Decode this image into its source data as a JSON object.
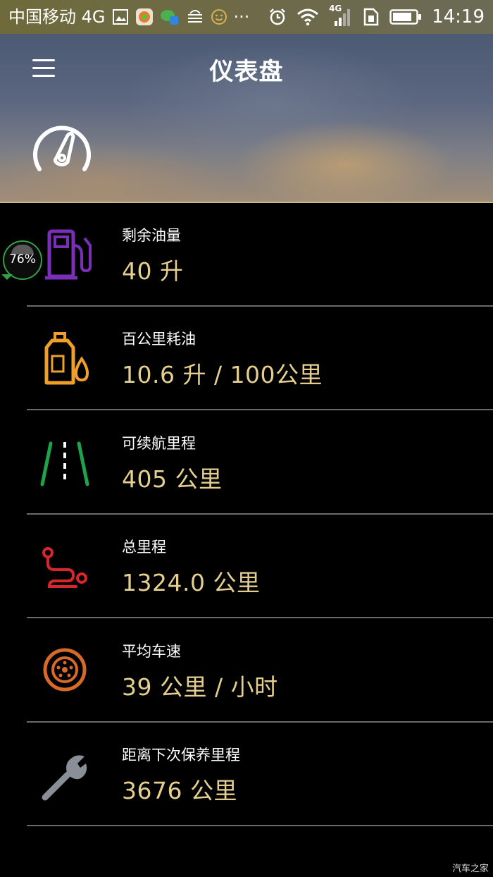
{
  "status_bar": {
    "carrier": "中国移动 4G",
    "network": "4G",
    "time": "14:19"
  },
  "header": {
    "title": "仪表盘"
  },
  "floating_badge": {
    "text": "76%"
  },
  "items": [
    {
      "label": "剩余油量",
      "value": "40 升",
      "icon": "fuel-pump-icon",
      "color": "#7b2fb8"
    },
    {
      "label": "百公里耗油",
      "value": "10.6 升 / 100公里",
      "icon": "oil-can-icon",
      "color": "#f0a028"
    },
    {
      "label": "可续航里程",
      "value": "405 公里",
      "icon": "road-icon",
      "color": "#1fa34a"
    },
    {
      "label": "总里程",
      "value": "1324.0 公里",
      "icon": "route-icon",
      "color": "#d8262b"
    },
    {
      "label": "平均车速",
      "value": "39 公里 / 小时",
      "icon": "wheel-icon",
      "color": "#d66a26"
    },
    {
      "label": "距离下次保养里程",
      "value": "3676 公里",
      "icon": "wrench-icon",
      "color": "#8a8f97"
    }
  ],
  "watermark": "汽车之家"
}
